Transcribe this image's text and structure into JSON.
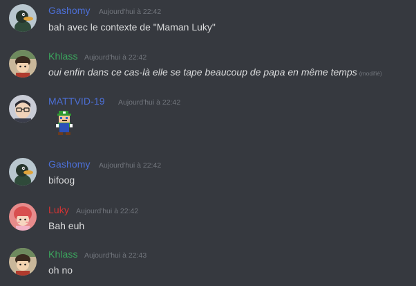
{
  "messages": [
    {
      "username": "Gashomy",
      "username_color": "#4c6fd6",
      "avatar": "duck-avatar",
      "timestamp": "Aujourd'hui à 22:42",
      "text": "bah avec le contexte de \"Maman Luky\""
    },
    {
      "username": "Khlass",
      "username_color": "#3ba55d",
      "avatar": "boy-avatar",
      "timestamp": "Aujourd'hui à 22:42",
      "text": "oui enfin dans ce cas-là elle se tape beaucoup de papa en même temps",
      "edited": "(modifié)"
    },
    {
      "username": "MATTVID-19",
      "username_color": "#4c6fd6",
      "avatar": "glasses-man-avatar",
      "timestamp": "Aujourd'hui à 22:42",
      "image": "luigi-sprite"
    },
    {
      "username": "Gashomy",
      "username_color": "#4c6fd6",
      "avatar": "duck-avatar",
      "timestamp": "Aujourd'hui à 22:42",
      "text": "bifoog"
    },
    {
      "username": "Luky",
      "username_color": "#d63333",
      "avatar": "girl-avatar",
      "timestamp": "Aujourd'hui à 22:42",
      "text": "Bah euh"
    },
    {
      "username": "Khlass",
      "username_color": "#3ba55d",
      "avatar": "boy-avatar",
      "timestamp": "Aujourd'hui à 22:43",
      "text": "oh no"
    }
  ]
}
